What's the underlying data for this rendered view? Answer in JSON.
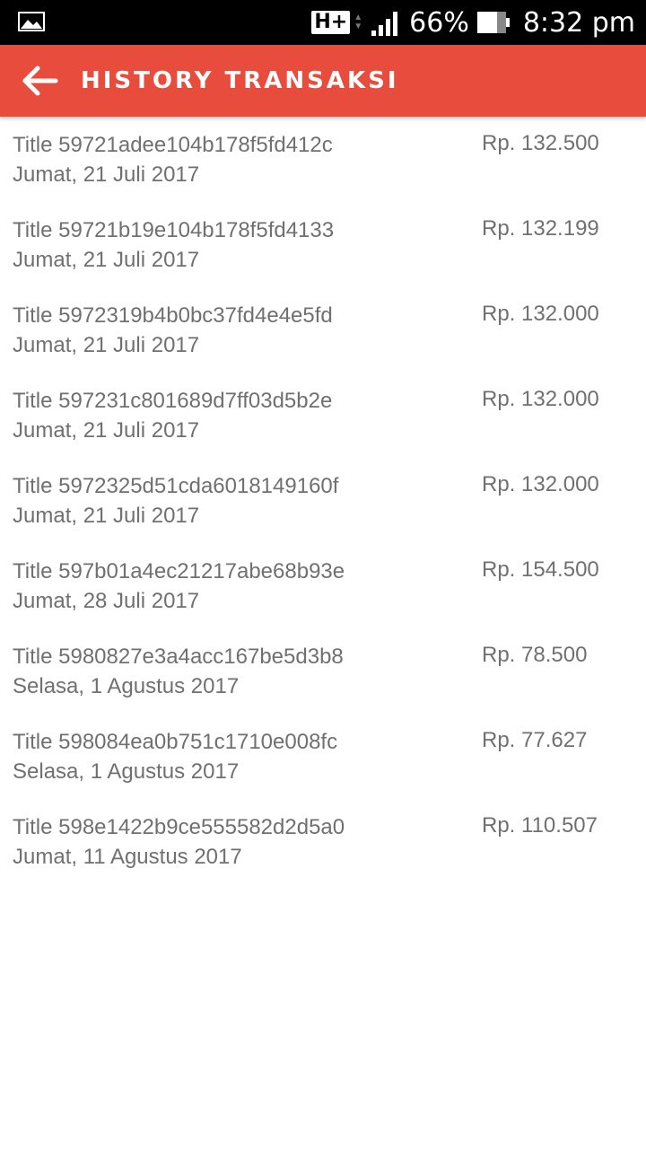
{
  "status_bar": {
    "network": "H+",
    "battery_percent": "66%",
    "time": "8:32 pm",
    "icons": [
      "image-icon",
      "network-hplus-icon",
      "signal-icon",
      "battery-icon"
    ]
  },
  "app_bar": {
    "title": "HISTORY TRANSAKSI",
    "back_icon": "arrow-left-icon",
    "color": "#e74c3c"
  },
  "transactions": [
    {
      "title": "Title 59721adee104b178f5fd412c",
      "date": "Jumat, 21 Juli 2017",
      "amount": "Rp. 132.500"
    },
    {
      "title": "Title 59721b19e104b178f5fd4133",
      "date": "Jumat, 21 Juli 2017",
      "amount": "Rp. 132.199"
    },
    {
      "title": "Title 5972319b4b0bc37fd4e4e5fd",
      "date": "Jumat, 21 Juli 2017",
      "amount": "Rp. 132.000"
    },
    {
      "title": "Title 597231c801689d7ff03d5b2e",
      "date": "Jumat, 21 Juli 2017",
      "amount": "Rp. 132.000"
    },
    {
      "title": "Title 5972325d51cda6018149160f",
      "date": "Jumat, 21 Juli 2017",
      "amount": "Rp. 132.000"
    },
    {
      "title": "Title 597b01a4ec21217abe68b93e",
      "date": "Jumat, 28 Juli 2017",
      "amount": "Rp. 154.500"
    },
    {
      "title": "Title 5980827e3a4acc167be5d3b8",
      "date": "Selasa, 1 Agustus 2017",
      "amount": "Rp. 78.500"
    },
    {
      "title": "Title 598084ea0b751c1710e008fc",
      "date": "Selasa, 1 Agustus 2017",
      "amount": "Rp. 77.627"
    },
    {
      "title": "Title 598e1422b9ce555582d2d5a0",
      "date": "Jumat, 11 Agustus 2017",
      "amount": "Rp. 110.507"
    }
  ]
}
